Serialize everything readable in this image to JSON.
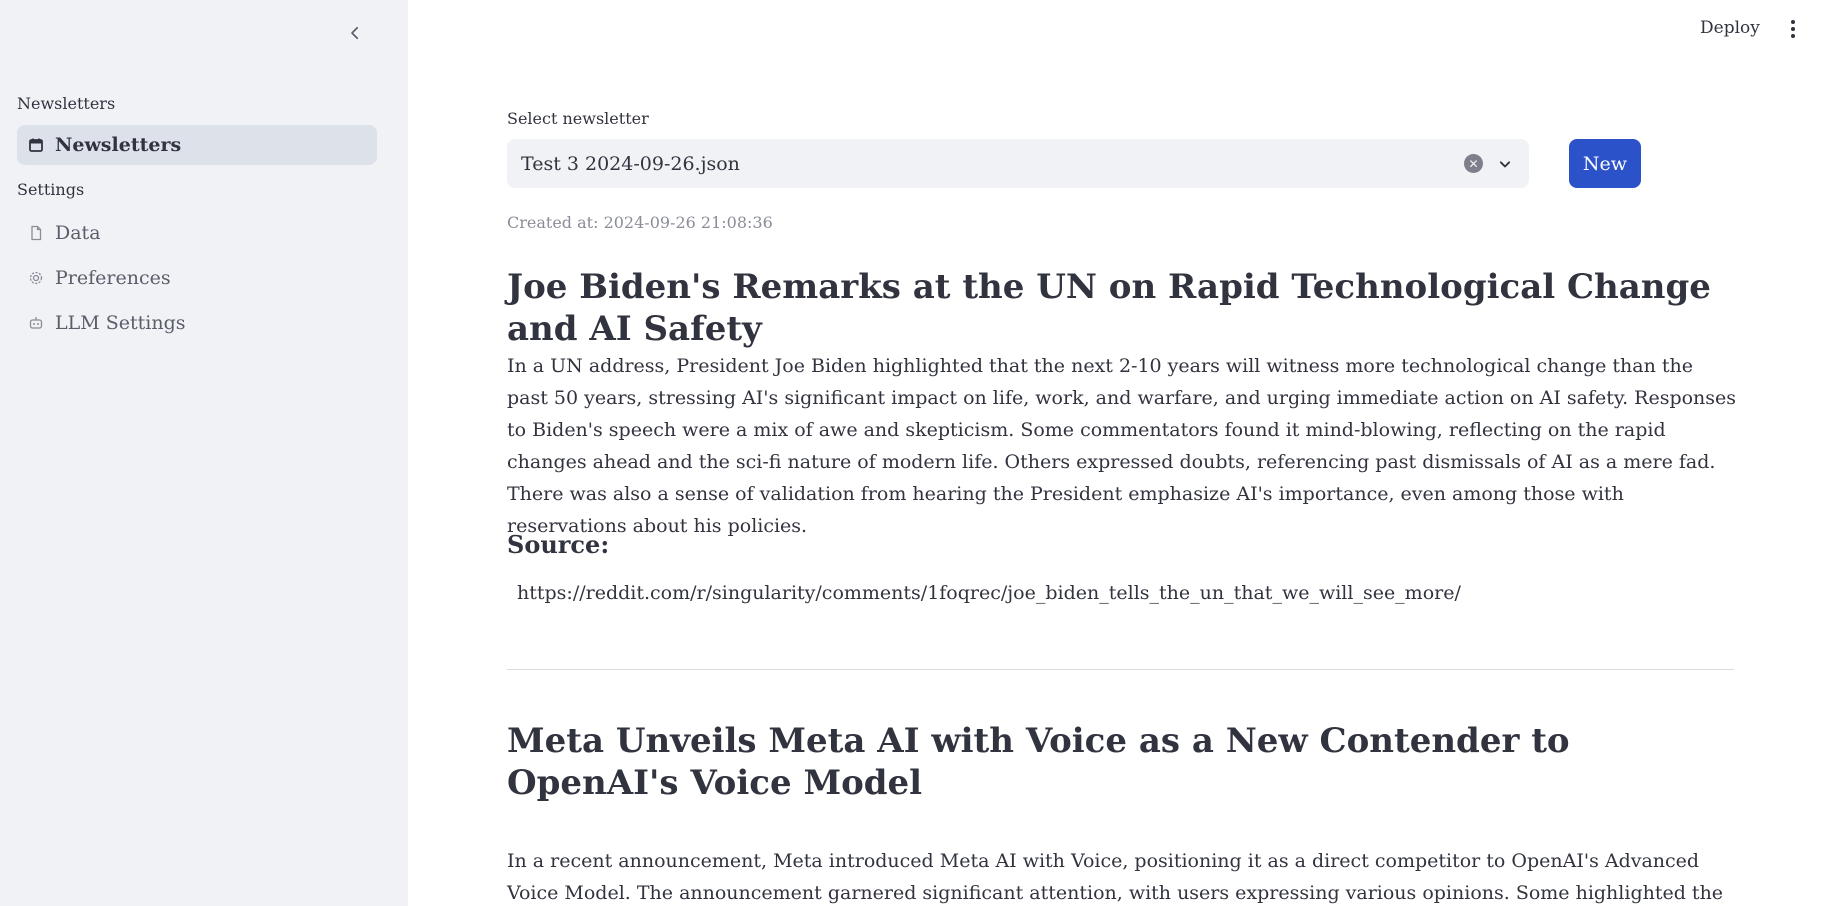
{
  "sidebar": {
    "sections": [
      {
        "title": "Newsletters",
        "items": [
          {
            "label": "Newsletters",
            "icon": "calendar-icon",
            "active": true
          }
        ]
      },
      {
        "title": "Settings",
        "items": [
          {
            "label": "Data",
            "icon": "file-icon"
          },
          {
            "label": "Preferences",
            "icon": "gear-icon"
          },
          {
            "label": "LLM Settings",
            "icon": "robot-icon"
          }
        ]
      }
    ]
  },
  "header": {
    "deploy_label": "Deploy"
  },
  "selector": {
    "label": "Select newsletter",
    "value": "Test 3 2024-09-26.json",
    "new_button": "New"
  },
  "created_at": "Created at: 2024-09-26 21:08:36",
  "articles": [
    {
      "title": "Joe Biden's Remarks at the UN on Rapid Technological Change and AI Safety",
      "body": "In a UN address, President Joe Biden highlighted that the next 2-10 years will witness more technological change than the past 50 years, stressing AI's significant impact on life, work, and warfare, and urging immediate action on AI safety. Responses to Biden's speech were a mix of awe and skepticism. Some commentators found it mind-blowing, reflecting on the rapid changes ahead and the sci-fi nature of modern life. Others expressed doubts, referencing past dismissals of AI as a mere fad. There was also a sense of validation from hearing the President emphasize AI's importance, even among those with reservations about his policies.",
      "source_heading": "Source:",
      "source_url": "https://reddit.com/r/singularity/comments/1foqrec/joe_biden_tells_the_un_that_we_will_see_more/"
    },
    {
      "title": "Meta Unveils Meta AI with Voice as a New Contender to OpenAI's Voice Model",
      "body": "In a recent announcement, Meta introduced Meta AI with Voice, positioning it as a direct competitor to OpenAI's Advanced Voice Model. The announcement garnered significant attention, with users expressing various opinions. Some highlighted the potential of celebrity"
    }
  ],
  "colors": {
    "accent": "#2c52c9",
    "sidebar_bg": "#f0f2f6",
    "text": "#31333f"
  }
}
